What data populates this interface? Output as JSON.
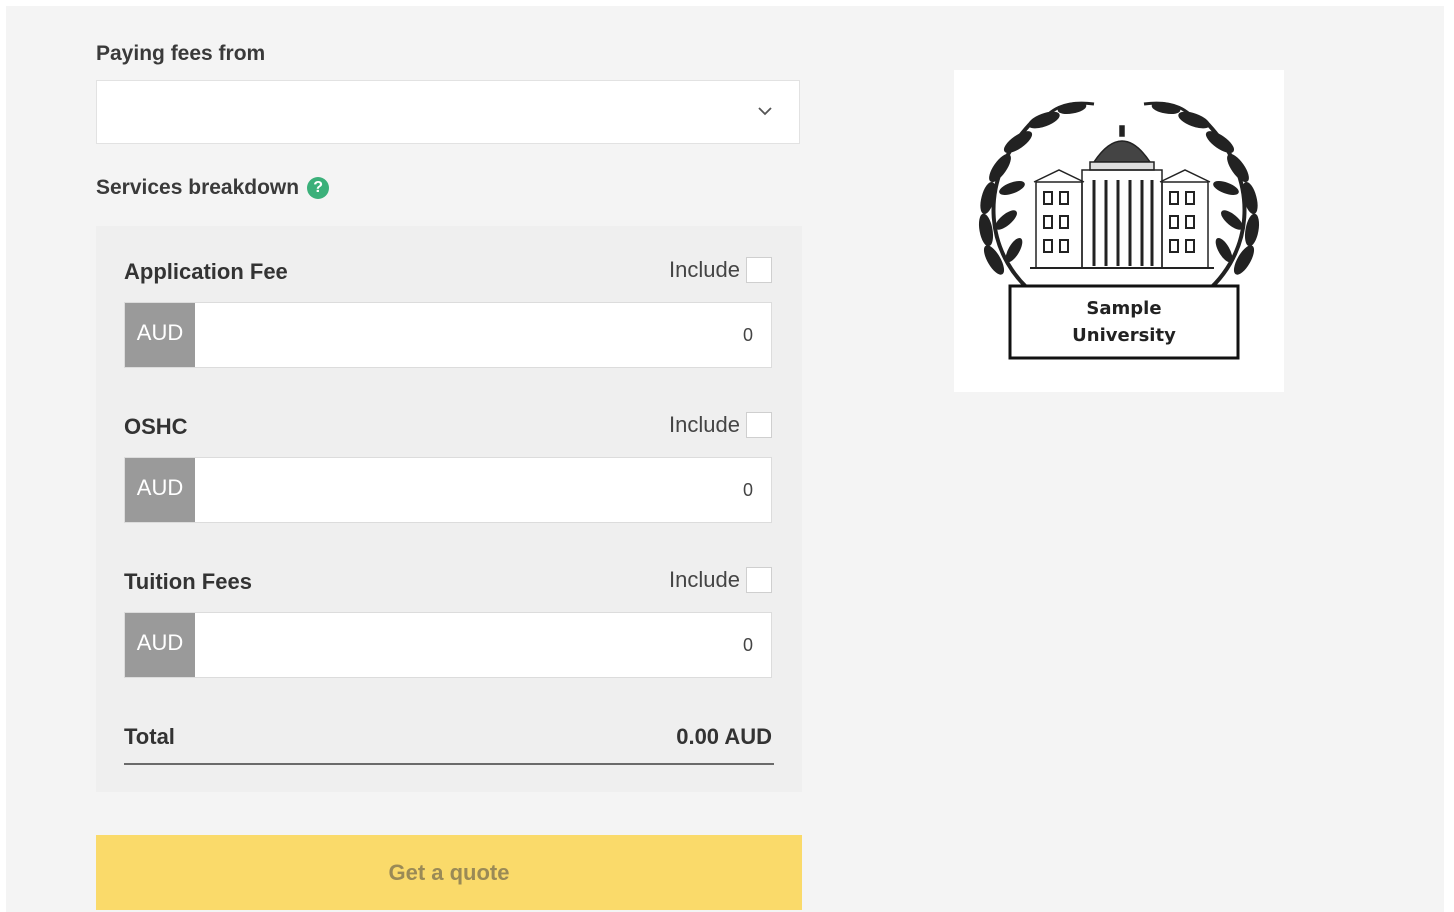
{
  "paying_from": {
    "label": "Paying fees from",
    "selected_value": "",
    "icon": "chevron-down-icon"
  },
  "services": {
    "label": "Services breakdown",
    "help_icon": "?",
    "help_icon_color": "#3bb07a",
    "items": [
      {
        "title": "Application Fee",
        "include_label": "Include",
        "included": false,
        "currency": "AUD",
        "amount": "0"
      },
      {
        "title": "OSHC",
        "include_label": "Include",
        "included": false,
        "currency": "AUD",
        "amount": "0"
      },
      {
        "title": "Tuition Fees",
        "include_label": "Include",
        "included": false,
        "currency": "AUD",
        "amount": "0"
      }
    ],
    "total_label": "Total",
    "total_value": "0.00 AUD"
  },
  "quote_button": {
    "label": "Get a quote",
    "color": "#fada6a"
  },
  "logo": {
    "line1": "Sample",
    "line2": "University"
  }
}
